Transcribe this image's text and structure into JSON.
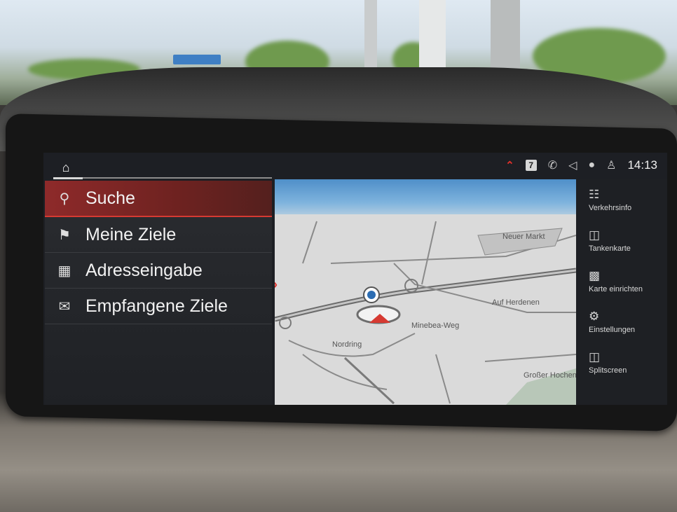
{
  "statusbar": {
    "badge_count": "7",
    "time": "14:13",
    "icons": [
      "home-icon",
      "chevron-up-icon",
      "notification-badge",
      "phone-bluetooth-icon",
      "volume-icon",
      "microphone-icon",
      "user-profile-icon"
    ]
  },
  "menu": {
    "items": [
      {
        "label": "Suche",
        "icon": "search-icon",
        "active": true
      },
      {
        "label": "Meine Ziele",
        "icon": "flag-person-icon",
        "active": false
      },
      {
        "label": "Adresseingabe",
        "icon": "buildings-icon",
        "active": false
      },
      {
        "label": "Empfangene Ziele",
        "icon": "flag-envelope-icon",
        "active": false
      }
    ]
  },
  "map": {
    "labels": {
      "neuer_markt": "Neuer Markt",
      "auf_herdenen": "Auf Herdenen",
      "minebea_weg": "Minebea-Weg",
      "nordring": "Nordring",
      "grosser_hochenwald": "Großer Hochenwa"
    }
  },
  "side": {
    "items": [
      {
        "label": "Verkehrsinfo",
        "icon": "traffic-info-icon"
      },
      {
        "label": "Tankenkarte",
        "icon": "fuel-map-icon"
      },
      {
        "label": "Karte einrichten",
        "icon": "map-settings-icon"
      },
      {
        "label": "Einstellungen",
        "icon": "gear-icon"
      },
      {
        "label": "Splitscreen",
        "icon": "splitscreen-icon"
      }
    ]
  },
  "colors": {
    "accent_red": "#d63a32",
    "screen_bg": "#1d1f24",
    "map_bg": "#dcdcdc"
  }
}
